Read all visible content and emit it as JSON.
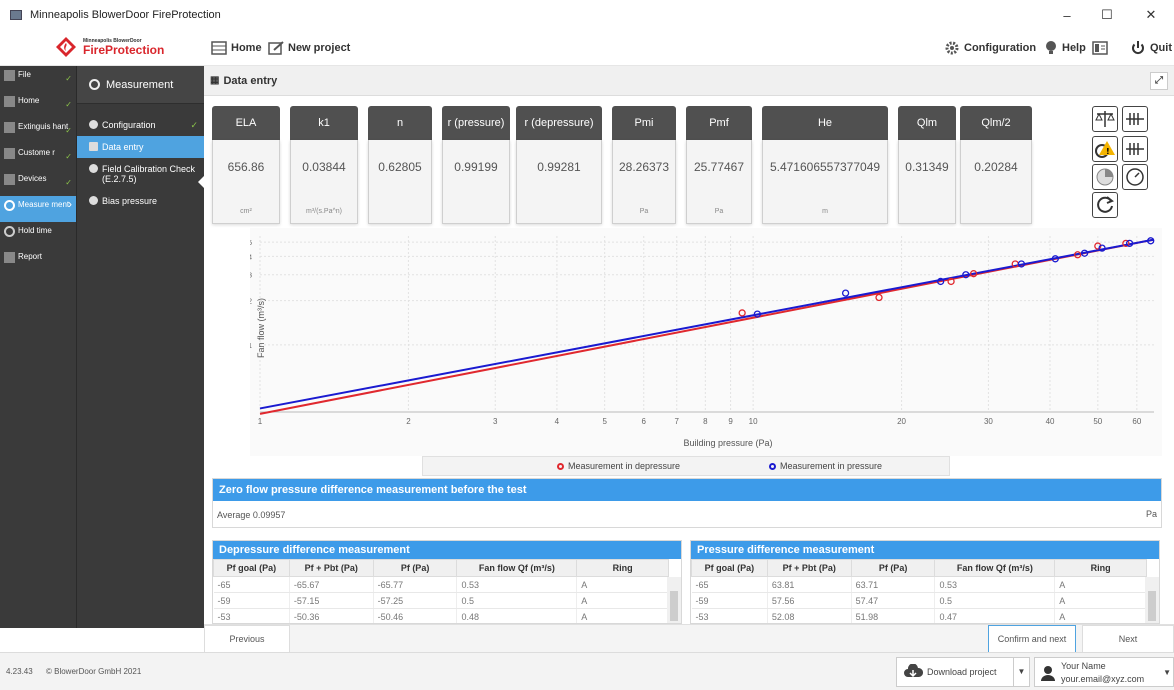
{
  "window": {
    "title": "Minneapolis BlowerDoor FireProtection",
    "minimize": "–",
    "maximize": "☐",
    "close": "✕"
  },
  "toolbar": {
    "logo_small": "Minneapolis BlowerDoor",
    "logo_big": "FireProtection",
    "home": "Home",
    "new_project": "New project",
    "configuration": "Configuration",
    "help": "Help",
    "quit": "Quit"
  },
  "sidebar": {
    "items": [
      {
        "label": "File",
        "check": "✓"
      },
      {
        "label": "Home",
        "check": "✓"
      },
      {
        "label": "Extinguis hant",
        "check": "✓"
      },
      {
        "label": "Custome r",
        "check": "✓"
      },
      {
        "label": "Devices",
        "check": "✓"
      },
      {
        "label": "Measure ment",
        "check": "›"
      },
      {
        "label": "Hold time",
        "check": ""
      },
      {
        "label": "Report",
        "check": ""
      }
    ]
  },
  "subnav": {
    "title": "Measurement",
    "items": [
      {
        "label": "Configuration",
        "check": "✓"
      },
      {
        "label": "Data entry",
        "check": ""
      },
      {
        "label": "Field Calibration Check (E.2.7.5)",
        "check": ""
      },
      {
        "label": "Bias pressure",
        "check": ""
      }
    ]
  },
  "main": {
    "header": "Data entry",
    "expand": "⤢"
  },
  "metrics": [
    {
      "name": "ELA",
      "value": "656.86",
      "unit": "cm²"
    },
    {
      "name": "k1",
      "value": "0.03844",
      "unit": "m³/(s.Pa^n)"
    },
    {
      "name": "n",
      "value": "0.62805",
      "unit": ""
    },
    {
      "name": "r (pressure)",
      "value": "0.99199",
      "unit": ""
    },
    {
      "name": "r (depressure)",
      "value": "0.99281",
      "unit": ""
    },
    {
      "name": "Pmi",
      "value": "28.26373",
      "unit": "Pa"
    },
    {
      "name": "Pmf",
      "value": "25.77467",
      "unit": "Pa"
    },
    {
      "name": "He",
      "value": "5.471606557377049",
      "unit": "m"
    },
    {
      "name": "Qlm",
      "value": "0.31349",
      "unit": ""
    },
    {
      "name": "Qlm/2",
      "value": "0.20284",
      "unit": ""
    }
  ],
  "chart_data": {
    "type": "scatter",
    "xlabel": "Building pressure (Pa)",
    "ylabel": "Fan flow (m³/s)",
    "xscale": "log",
    "yscale": "log",
    "xlim": [
      1,
      65
    ],
    "ylim": [
      0.035,
      0.55
    ],
    "xticks": [
      1,
      2,
      3,
      4,
      5,
      6,
      7,
      8,
      9,
      10,
      20,
      30,
      40,
      50,
      60
    ],
    "yticks": [
      0.1,
      0.2,
      0.3,
      0.4,
      0.5
    ],
    "grid": true,
    "series": [
      {
        "name": "Measurement in depressure",
        "color": "#e0282e",
        "points": [
          [
            9.5,
            0.165
          ],
          [
            18,
            0.21
          ],
          [
            25.2,
            0.27
          ],
          [
            28,
            0.305
          ],
          [
            34,
            0.355
          ],
          [
            45.5,
            0.41
          ],
          [
            50,
            0.47
          ],
          [
            57,
            0.49
          ]
        ],
        "fit": [
          [
            1,
            0.034
          ],
          [
            65,
            0.52
          ]
        ]
      },
      {
        "name": "Measurement in pressure",
        "color": "#1a1ad0",
        "points": [
          [
            10.2,
            0.162
          ],
          [
            15.4,
            0.225
          ],
          [
            24,
            0.27
          ],
          [
            27,
            0.3
          ],
          [
            35,
            0.355
          ],
          [
            41,
            0.385
          ],
          [
            47,
            0.42
          ],
          [
            51,
            0.455
          ],
          [
            58,
            0.49
          ],
          [
            64,
            0.51
          ]
        ],
        "fit": [
          [
            1,
            0.037
          ],
          [
            65,
            0.52
          ]
        ]
      }
    ]
  },
  "zero": {
    "title": "Zero flow pressure difference measurement before the test",
    "average": "Average 0.09957",
    "unit": "Pa"
  },
  "tables": {
    "headers": [
      "Pf goal (Pa)",
      "Pf + Pbt (Pa)",
      "Pf (Pa)",
      "Fan flow Qf (m³/s)",
      "Ring"
    ],
    "depressure": {
      "title": "Depressure difference measurement",
      "rows": [
        [
          "-65",
          "-65.67",
          "-65.77",
          "0.53",
          "A"
        ],
        [
          "-59",
          "-57.15",
          "-57.25",
          "0.5",
          "A"
        ],
        [
          "-53",
          "-50.36",
          "-50.46",
          "0.48",
          "A"
        ]
      ]
    },
    "pressure": {
      "title": "Pressure difference measurement",
      "rows": [
        [
          "-65",
          "63.81",
          "63.71",
          "0.53",
          "A"
        ],
        [
          "-59",
          "57.56",
          "57.47",
          "0.5",
          "A"
        ],
        [
          "-53",
          "52.08",
          "51.98",
          "0.47",
          "A"
        ]
      ]
    }
  },
  "nav": {
    "previous": "Previous",
    "confirm": "Confirm and next",
    "next": "Next"
  },
  "status": {
    "version": "4.23.43",
    "copyright": "© BlowerDoor GmbH 2021",
    "download": "Download project",
    "user_name": "Your Name",
    "user_email": "your.email@xyz.com"
  }
}
